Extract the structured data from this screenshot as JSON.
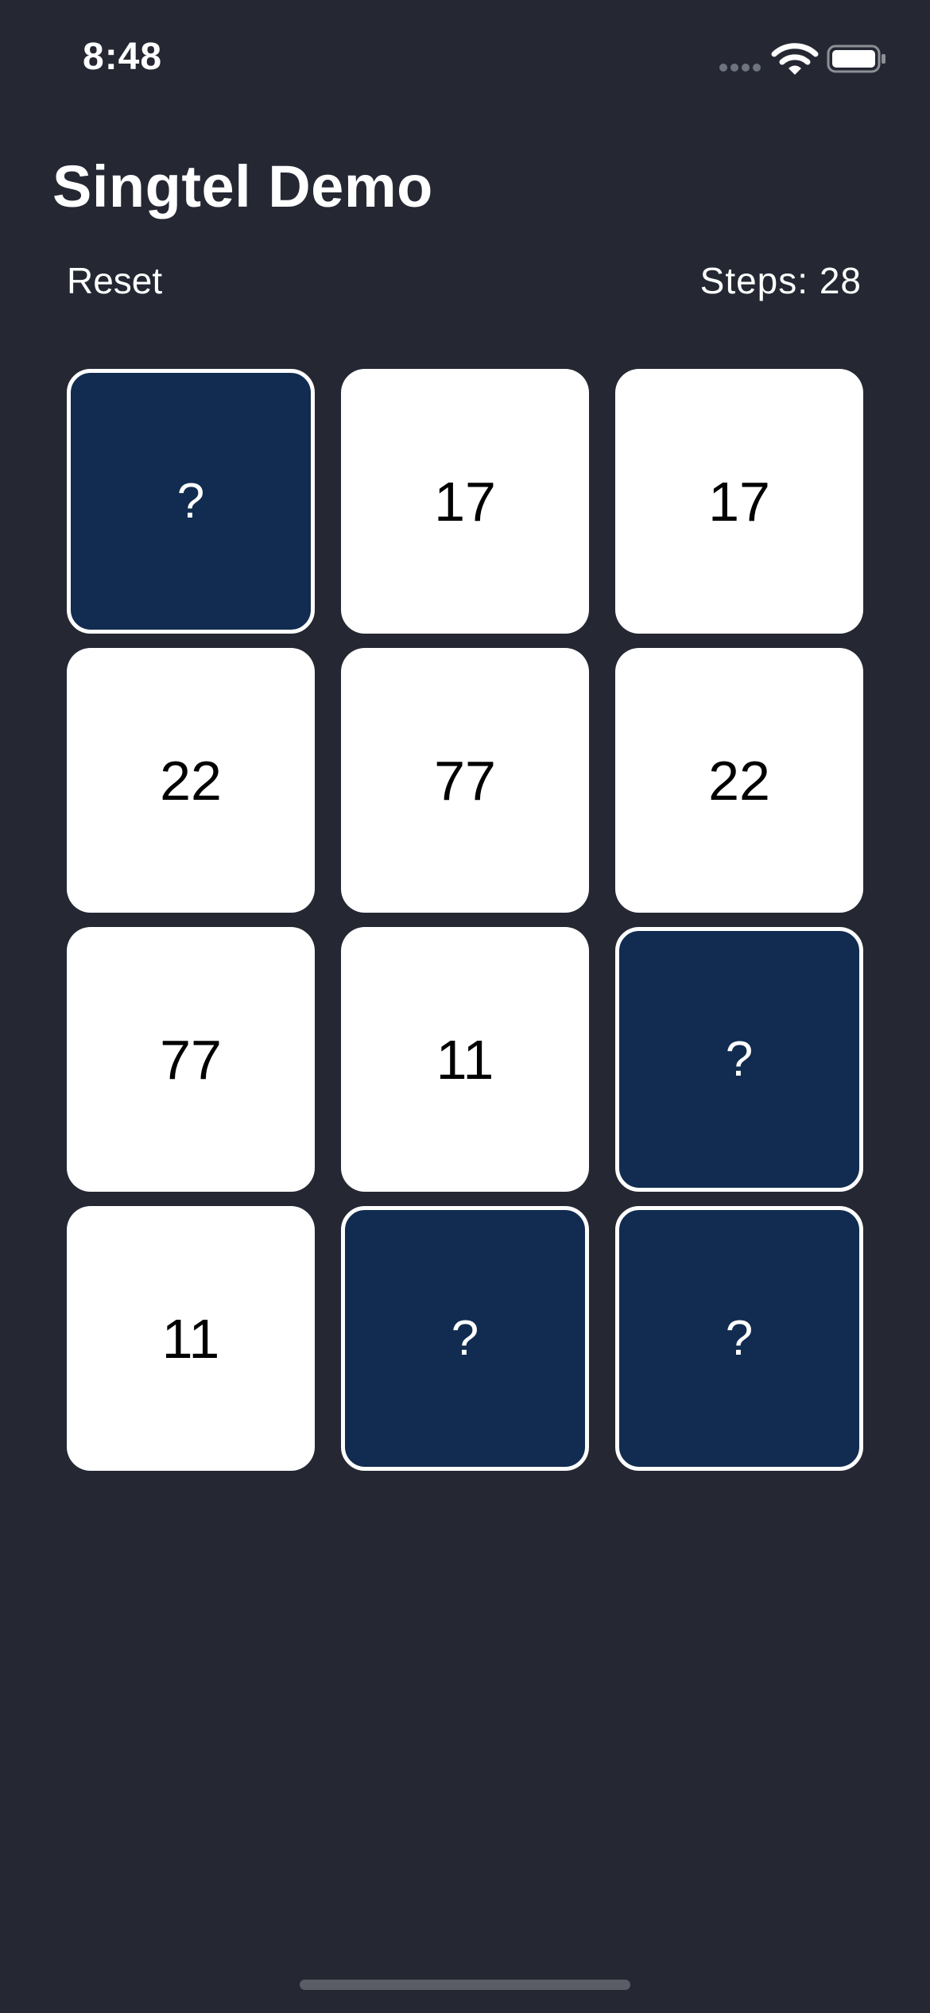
{
  "status_bar": {
    "time": "8:48",
    "icons": [
      "signal-icon",
      "wifi-icon",
      "battery-icon"
    ]
  },
  "title": "Singtel Demo",
  "toolbar": {
    "reset_label": "Reset",
    "steps_label": "Steps: 28"
  },
  "cards": [
    {
      "label": "?",
      "state": "hidden"
    },
    {
      "label": "17",
      "state": "revealed"
    },
    {
      "label": "17",
      "state": "revealed"
    },
    {
      "label": "22",
      "state": "revealed"
    },
    {
      "label": "77",
      "state": "revealed"
    },
    {
      "label": "22",
      "state": "revealed"
    },
    {
      "label": "77",
      "state": "revealed"
    },
    {
      "label": "11",
      "state": "revealed"
    },
    {
      "label": "?",
      "state": "hidden"
    },
    {
      "label": "11",
      "state": "revealed"
    },
    {
      "label": "?",
      "state": "hidden"
    },
    {
      "label": "?",
      "state": "hidden"
    }
  ],
  "colors": {
    "background": "#252833",
    "hidden_card": "#112c50",
    "revealed_card": "#ffffff"
  }
}
